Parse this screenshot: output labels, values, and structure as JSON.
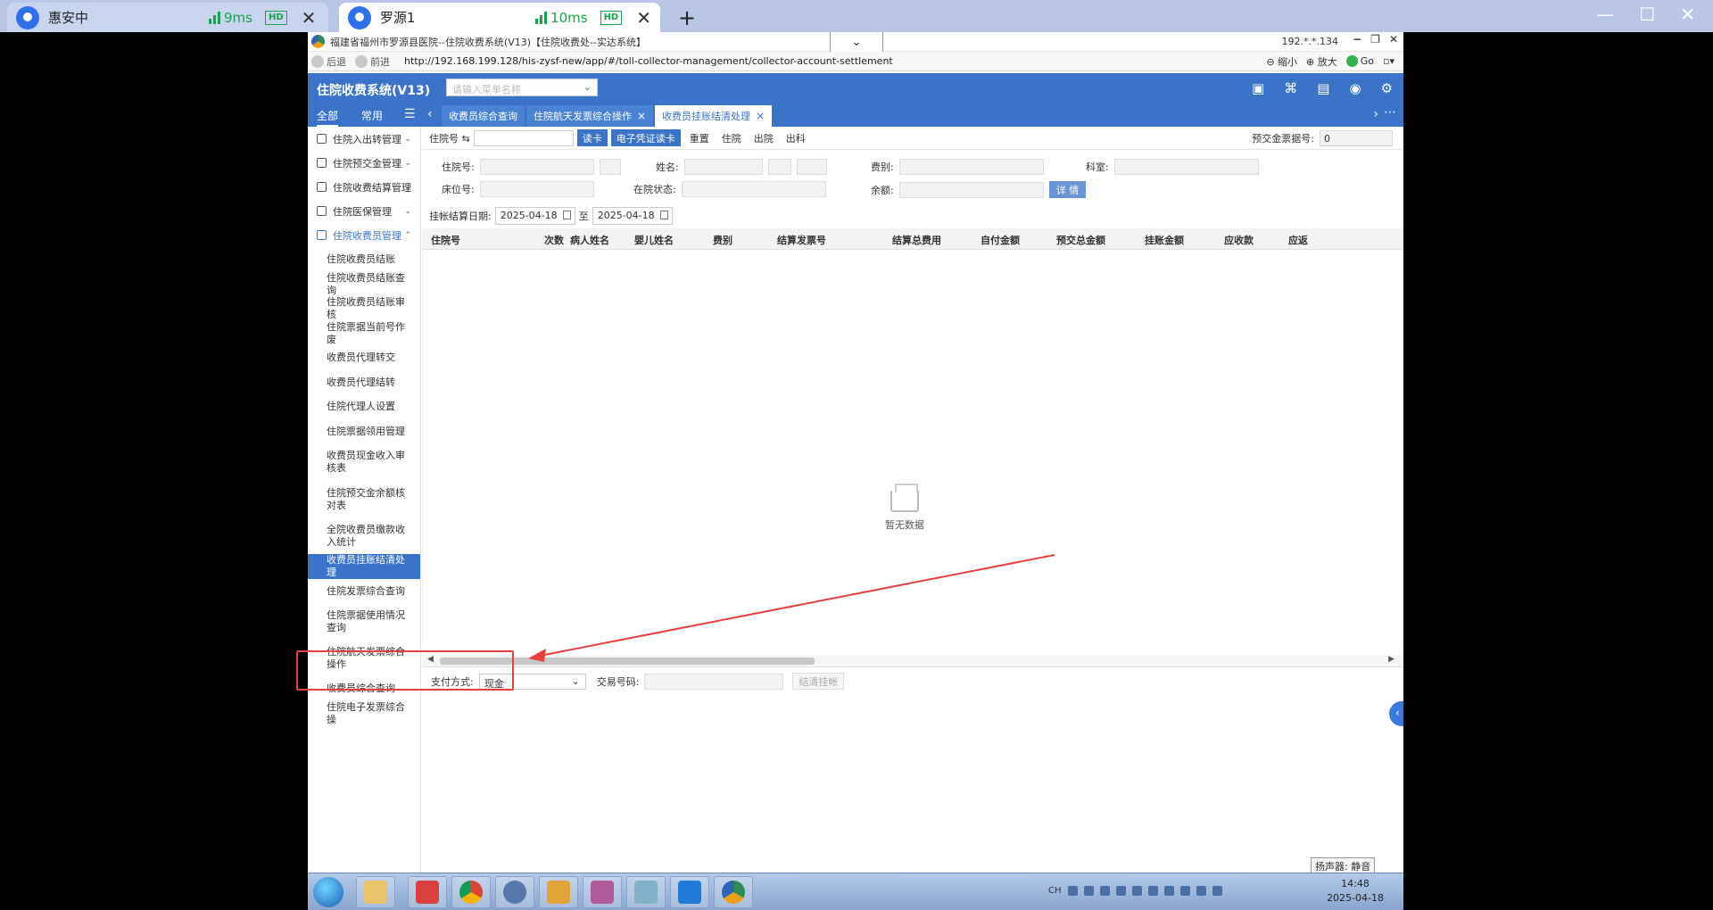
{
  "outer_tabs": [
    {
      "title": "惠安中",
      "latency": "9ms",
      "hd": "HD"
    },
    {
      "title": "罗源1",
      "latency": "10ms",
      "hd": "HD"
    }
  ],
  "window": {
    "title": "福建省福州市罗源县医院--住院收费系统(V13)【住院收费处--实达系统】",
    "ip": "192.*.*.134",
    "nav": {
      "back": "后退",
      "forward": "前进",
      "url": "http://192.168.199.128/his-zysf-new/app/#/toll-collector-management/collector-account-settlement",
      "zoom_out": "缩小",
      "zoom_in": "放大",
      "go": "Go"
    }
  },
  "app": {
    "system_name": "住院收费系统(V13)",
    "search_placeholder": "请输入菜单名称",
    "side_tabs": {
      "all": "全部",
      "common": "常用"
    },
    "tabs": [
      {
        "label": "收费员综合查询"
      },
      {
        "label": "住院航天发票综合操作",
        "close": "×"
      },
      {
        "label": "收费员挂账结清处理",
        "close": "×"
      }
    ]
  },
  "sidebar": {
    "groups": [
      {
        "label": "住院入出转管理"
      },
      {
        "label": "住院预交金管理"
      },
      {
        "label": "住院收费结算管理"
      },
      {
        "label": "住院医保管理"
      },
      {
        "label": "住院收费员管理"
      }
    ],
    "items": [
      "住院收费员结账",
      "住院收费员结账查询",
      "住院收费员结账审核",
      "住院票据当前号作废",
      "收费员代理转交",
      "收费员代理结转",
      "住院代理人设置",
      "住院票据领用管理",
      "收费员现金收入审核表",
      "住院预交金余额核对表",
      "全院收费员缴款收入统计",
      "收费员挂账结清处理",
      "住院发票综合查询",
      "住院票据使用情况查询",
      "住院航天发票综合操作",
      "收费员综合查询",
      "住院电子发票综合操"
    ]
  },
  "toolbar": {
    "admission_label": "住院号 ⇆",
    "read_card": "读卡",
    "e_voucher": "电子凭证读卡",
    "reset": "重置",
    "admit": "住院",
    "discharge": "出院",
    "dept_out": "出科",
    "prepay_label": "预交金票据号:",
    "prepay_value": "0"
  },
  "form": {
    "admission_no": "住院号:",
    "name": "姓名:",
    "fee_type": "费别:",
    "department": "科室:",
    "bed_no": "床位号:",
    "status": "在院状态:",
    "balance": "余额:",
    "detail": "详 情"
  },
  "date_filter": {
    "label": "挂帐结算日期:",
    "start": "2025-04-18",
    "to": "至",
    "end": "2025-04-18"
  },
  "grid": {
    "columns": [
      "住院号",
      "次数",
      "病人姓名",
      "婴儿姓名",
      "费别",
      "结算发票号",
      "结算总费用",
      "自付金额",
      "预交总金额",
      "挂账金额",
      "应收款",
      "应返"
    ],
    "empty_text": "暂无数据"
  },
  "footer": {
    "payment_label": "支付方式:",
    "payment_value": "现金",
    "trans_label": "交易号码:",
    "settle_button": "结清挂帐"
  },
  "status": {
    "speaker": "扬声器: 静音",
    "time": "14:48",
    "date": "2025-04-18",
    "lang": "CH"
  },
  "colors": {
    "brand": "#3b73c8",
    "highlight_box": "#e84040"
  }
}
